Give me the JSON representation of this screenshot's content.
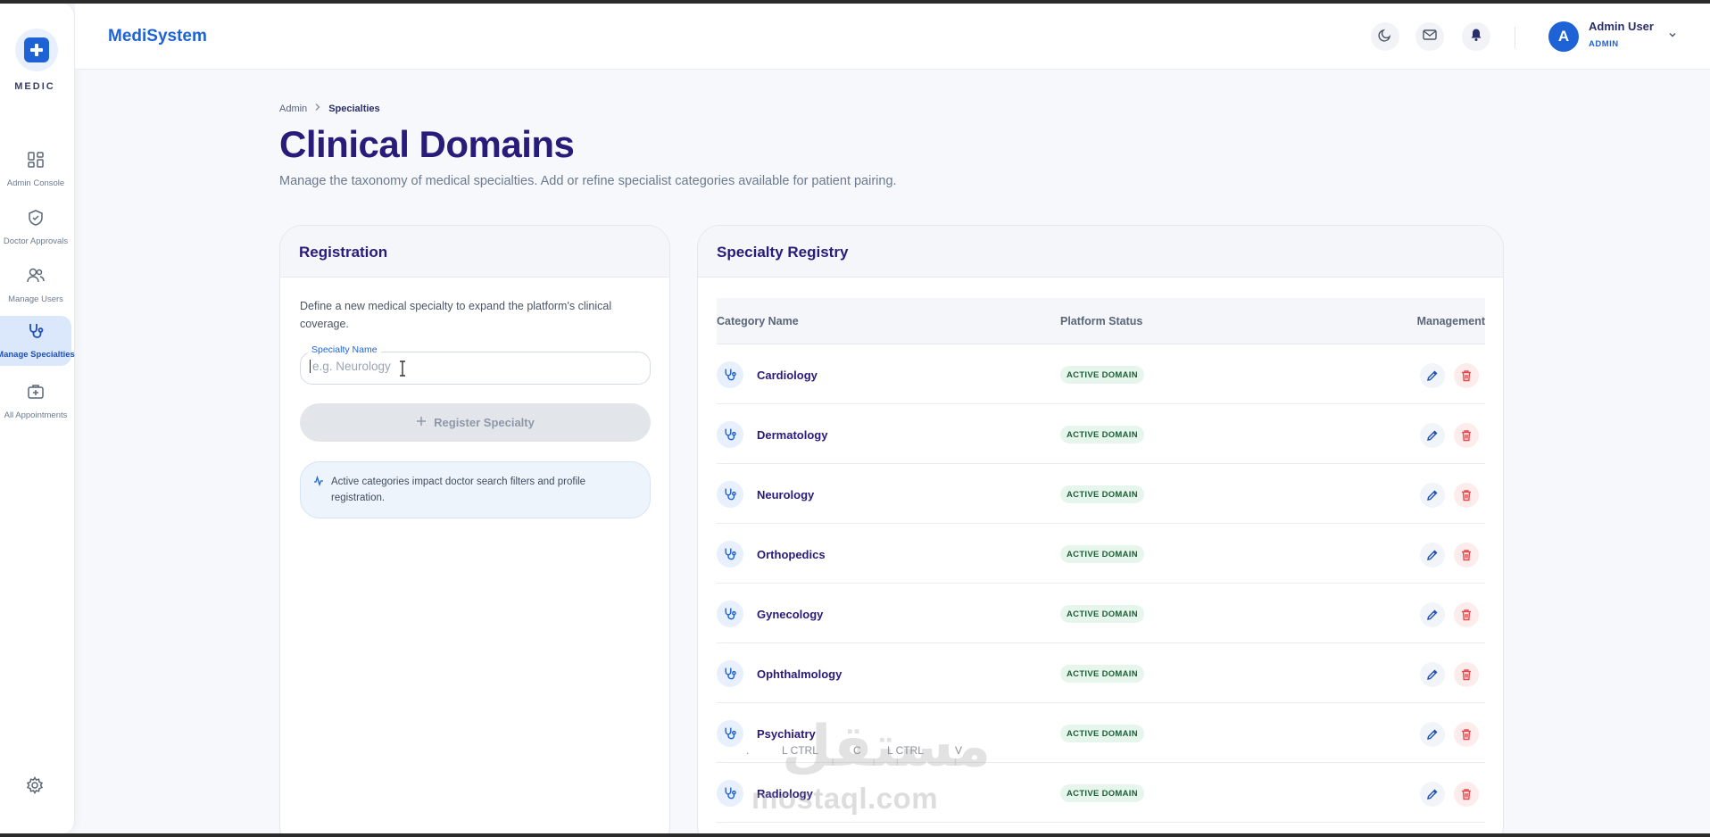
{
  "app": {
    "logo_text": "MEDIC",
    "brand": "MediSystem"
  },
  "sidebar": {
    "items": [
      {
        "label": "Admin Console",
        "icon": "dashboard-icon",
        "active": false
      },
      {
        "label": "Doctor Approvals",
        "icon": "shield-check-icon",
        "active": false
      },
      {
        "label": "Manage Users",
        "icon": "users-icon",
        "active": false
      },
      {
        "label": "Manage Specialties",
        "icon": "stethoscope-icon",
        "active": true
      },
      {
        "label": "All Appointments",
        "icon": "medical-bag-icon",
        "active": false
      }
    ],
    "settings_icon": "gear-icon"
  },
  "header": {
    "icons": [
      "moon-icon",
      "mail-icon",
      "bell-icon"
    ],
    "user": {
      "initial": "A",
      "name": "Admin User",
      "role": "ADMIN"
    }
  },
  "page": {
    "breadcrumb": {
      "root": "Admin",
      "current": "Specialties"
    },
    "title": "Clinical Domains",
    "subtitle": "Manage the taxonomy of medical specialties. Add or refine specialist categories available for patient pairing."
  },
  "registration": {
    "title": "Registration",
    "description": "Define a new medical specialty to expand the platform's clinical coverage.",
    "field_label": "Specialty Name",
    "field_placeholder": "e.g. Neurology",
    "field_value": "",
    "button_label": "Register Specialty",
    "info_text": "Active categories impact doctor search filters and profile registration."
  },
  "registry": {
    "title": "Specialty Registry",
    "columns": {
      "name": "Category Name",
      "status": "Platform Status",
      "management": "Management"
    },
    "rows": [
      {
        "name": "Cardiology",
        "status": "ACTIVE DOMAIN"
      },
      {
        "name": "Dermatology",
        "status": "ACTIVE DOMAIN"
      },
      {
        "name": "Neurology",
        "status": "ACTIVE DOMAIN"
      },
      {
        "name": "Orthopedics",
        "status": "ACTIVE DOMAIN"
      },
      {
        "name": "Gynecology",
        "status": "ACTIVE DOMAIN"
      },
      {
        "name": "Ophthalmology",
        "status": "ACTIVE DOMAIN"
      },
      {
        "name": "Psychiatry",
        "status": "ACTIVE DOMAIN"
      },
      {
        "name": "Radiology",
        "status": "ACTIVE DOMAIN"
      }
    ]
  },
  "overlay": {
    "keys": [
      ".",
      "L CTRL",
      "C",
      "L CTRL",
      "V"
    ],
    "watermark_ar": "مستقل",
    "watermark_en": "mostaql.com"
  },
  "colors": {
    "primary": "#1e63d6",
    "heading": "#2a1a7a",
    "badge_bg": "#e7f6ec",
    "badge_text": "#1f5d38",
    "danger": "#e5484d"
  }
}
